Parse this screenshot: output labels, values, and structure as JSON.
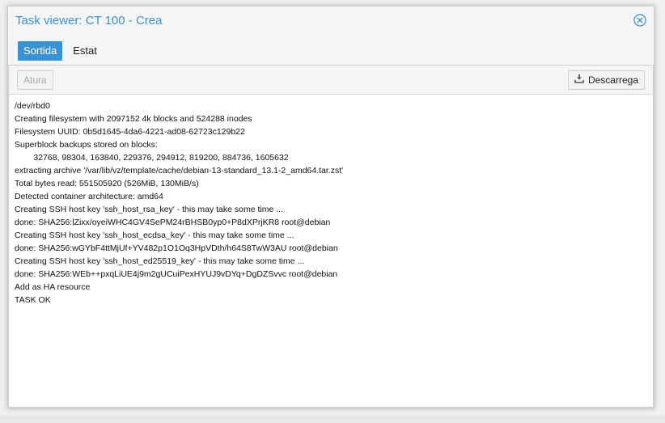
{
  "window": {
    "title": "Task viewer: CT 100 - Crea"
  },
  "tabs": [
    {
      "label": "Sortida",
      "active": true
    },
    {
      "label": "Estat",
      "active": false
    }
  ],
  "toolbar": {
    "stop_label": "Atura",
    "download_label": "Descarrega",
    "download_icon": "download-icon"
  },
  "log": {
    "lines": [
      "/dev/rbd0",
      "Creating filesystem with 2097152 4k blocks and 524288 inodes",
      "Filesystem UUID: 0b5d1645-4da6-4221-ad08-62723c129b22",
      "Superblock backups stored on blocks:",
      "        32768, 98304, 163840, 229376, 294912, 819200, 884736, 1605632",
      "extracting archive '/var/lib/vz/template/cache/debian-13-standard_13.1-2_amd64.tar.zst'",
      "Total bytes read: 551505920 (526MiB, 130MiB/s)",
      "Detected container architecture: amd64",
      "Creating SSH host key 'ssh_host_rsa_key' - this may take some time ...",
      "done: SHA256:lZixx/oyeiWHC4GV4SePM24rBHSB0yp0+P8dXPrjKR8 root@debian",
      "Creating SSH host key 'ssh_host_ecdsa_key' - this may take some time ...",
      "done: SHA256:wGYbF4ttMjUf+YV482p1O1Oq3HpVDth/h64S8TwW3AU root@debian",
      "Creating SSH host key 'ssh_host_ed25519_key' - this may take some time ...",
      "done: SHA256:WEb++pxqLiUE4j9m2gUCuiPexHYUJ9vDYq+DgDZSvvc root@debian",
      "Add as HA resource",
      "TASK OK"
    ]
  },
  "colors": {
    "accent": "#3892d4",
    "title": "#3892d4"
  }
}
